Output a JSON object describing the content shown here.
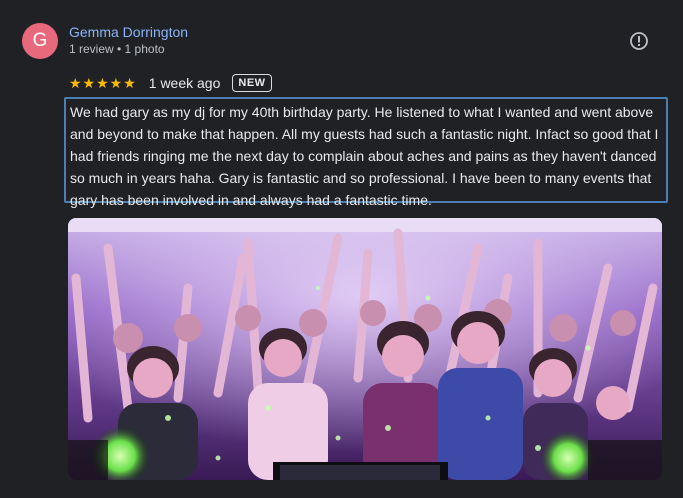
{
  "reviewer": {
    "initial": "G",
    "name": "Gemma Dorrington",
    "meta": "1 review • 1 photo",
    "avatar_color": "#e8697b"
  },
  "rating": {
    "stars_display": "★★★★★",
    "stars": 5,
    "time": "1 week ago",
    "badge": "NEW"
  },
  "review": {
    "text": "We had gary as my dj for my 40th birthday party. He listened to what I wanted and went above and beyond to make that happen. All my guests had such a fantastic night. Infact so good that I had friends ringing me the next day to complain about aches and pains as they haven't danced so much in years haha. Gary is fantastic and so professional. I have been to many events that gary has been involved in and always had a fantastic time."
  },
  "icons": {
    "report": "report-flag-icon"
  },
  "colors": {
    "background": "#202124",
    "name_link": "#8ab4f8",
    "star": "#fbbc04",
    "highlight_border": "#4b7fb3"
  }
}
